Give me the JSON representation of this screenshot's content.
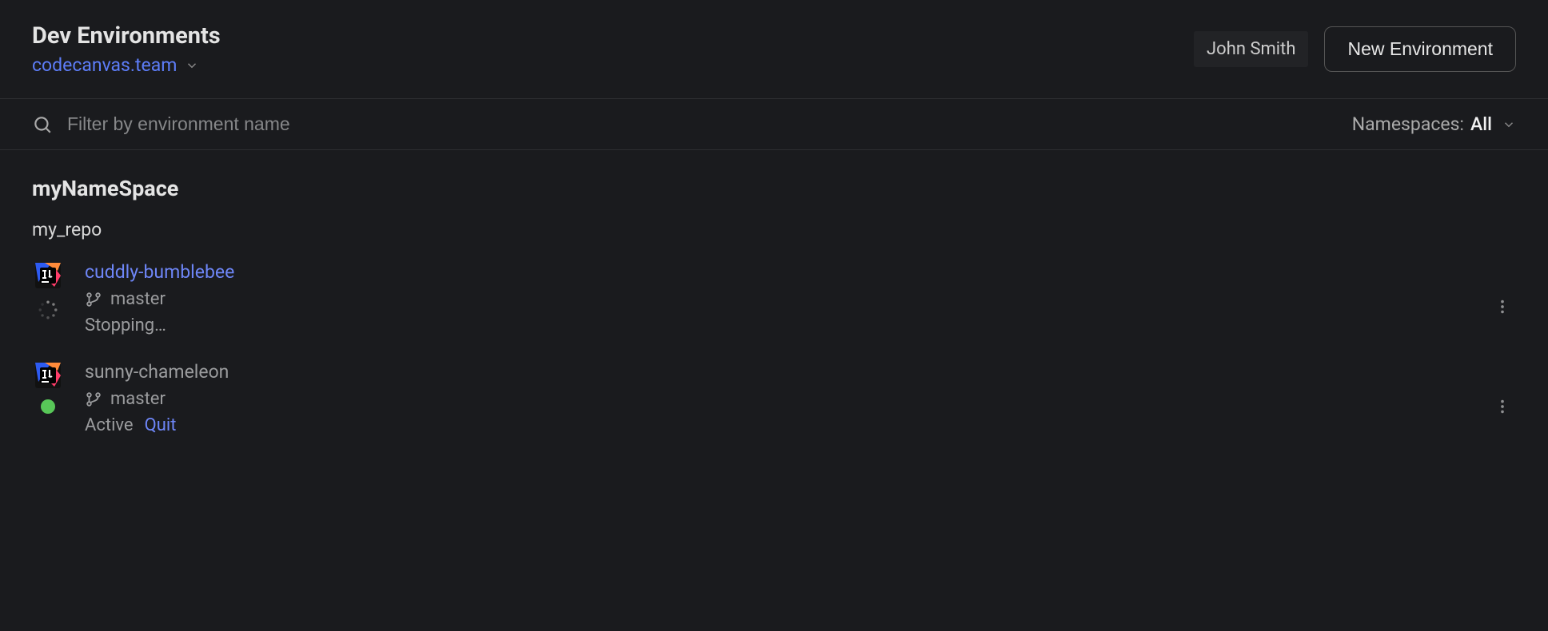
{
  "header": {
    "title": "Dev Environments",
    "team_label": "codecanvas.team",
    "user_name": "John Smith",
    "new_env_label": "New Environment"
  },
  "filter": {
    "placeholder": "Filter by environment name",
    "value": "",
    "namespaces_label": "Namespaces:",
    "namespaces_value": "All"
  },
  "namespace": {
    "name": "myNameSpace",
    "repo": "my_repo",
    "environments": [
      {
        "name": "cuddly-bumblebee",
        "branch": "master",
        "status_text": "Stopping…",
        "state": "stopping",
        "name_style": "link"
      },
      {
        "name": "sunny-chameleon",
        "branch": "master",
        "status_text": "Active",
        "state": "active",
        "name_style": "muted",
        "action_label": "Quit"
      }
    ]
  },
  "icons": {
    "ide": "intellij-icon",
    "branch": "git-branch-icon",
    "search": "search-icon",
    "chevron": "chevron-down-icon",
    "kebab": "more-vertical-icon",
    "spinner": "loading-spinner-icon"
  }
}
